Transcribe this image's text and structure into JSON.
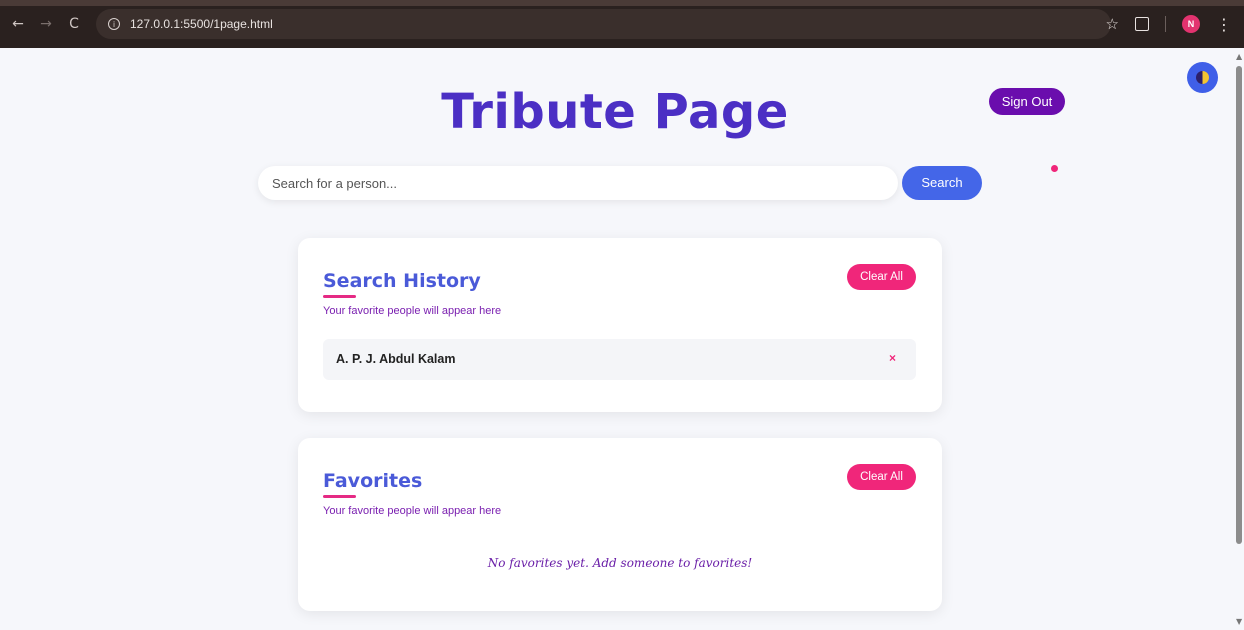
{
  "browser": {
    "back_icon": "←",
    "forward_icon": "→",
    "reload_icon": "C",
    "url": "127.0.0.1:5500/1page.html",
    "info_icon": "i",
    "bookmark_icon": "☆",
    "profile_initial": "N",
    "menu_icon": "⋮"
  },
  "header": {
    "title": "Tribute Page",
    "signout_label": "Sign Out"
  },
  "search": {
    "placeholder": "Search for a person...",
    "button_label": "Search"
  },
  "history": {
    "title": "Search History",
    "subtitle": "Your favorite people will appear here",
    "clear_label": "Clear All",
    "items": [
      {
        "name": "A. P. J. Abdul Kalam",
        "remove_icon": "×"
      }
    ]
  },
  "favorites": {
    "title": "Favorites",
    "subtitle": "Your favorite people will appear here",
    "clear_label": "Clear All",
    "empty_message": "No favorites yet. Add someone to favorites!"
  },
  "colors": {
    "title": "#4b2fc4",
    "accent_pink": "#f0267a",
    "search_blue": "#4466e8",
    "signout_purple": "#6a0dad"
  }
}
